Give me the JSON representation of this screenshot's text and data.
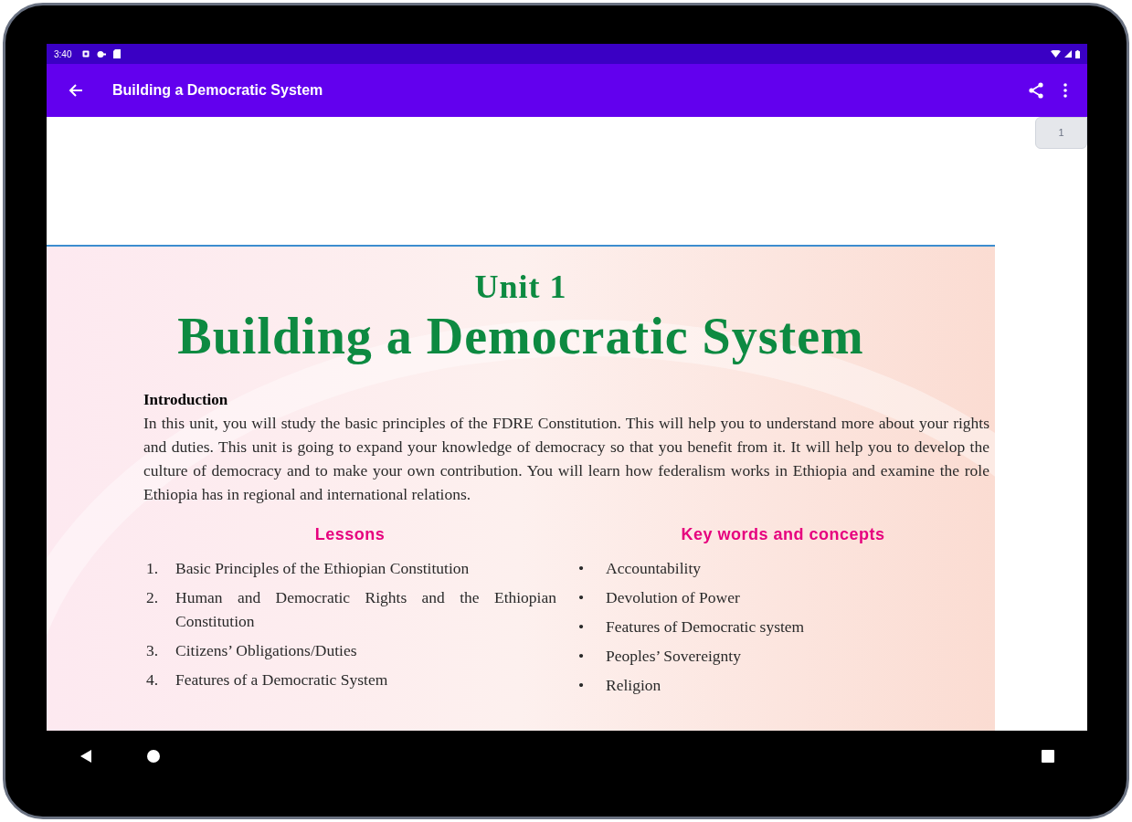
{
  "status_bar": {
    "time": "3:40"
  },
  "app_bar": {
    "title": "Building a Democratic System"
  },
  "page_indicator": "1",
  "document": {
    "unit": "Unit 1",
    "title": "Building a Democratic System",
    "introduction": {
      "heading": "Introduction",
      "text": "In this unit, you will study the basic principles of the FDRE Constitution. This will help you to understand more about your rights and duties. This unit is going to expand your knowledge of democracy so that you benefit from it. It will help you to develop the culture of democracy and to make your own contribution. You will learn how federalism works in Ethiopia and examine the role Ethiopia has in regional and international relations."
    },
    "lessons": {
      "heading": "Lessons",
      "items": [
        {
          "number": "1.",
          "text": "Basic Principles of the Ethiopian Constitution"
        },
        {
          "number": "2.",
          "text": "Human and Democratic Rights and the Ethiopian Constitution"
        },
        {
          "number": "3.",
          "text": "Citizens’ Obligations/Duties"
        },
        {
          "number": "4.",
          "text": "Features of a Democratic System"
        }
      ]
    },
    "key_words": {
      "heading": "Key words and concepts",
      "items": [
        {
          "bullet": "•",
          "text": "Accountability"
        },
        {
          "bullet": "•",
          "text": "Devolution of Power"
        },
        {
          "bullet": "•",
          "text": "Features of Democratic system"
        },
        {
          "bullet": "•",
          "text": "Peoples’ Sovereignty"
        },
        {
          "bullet": "•",
          "text": "Religion"
        }
      ]
    }
  }
}
